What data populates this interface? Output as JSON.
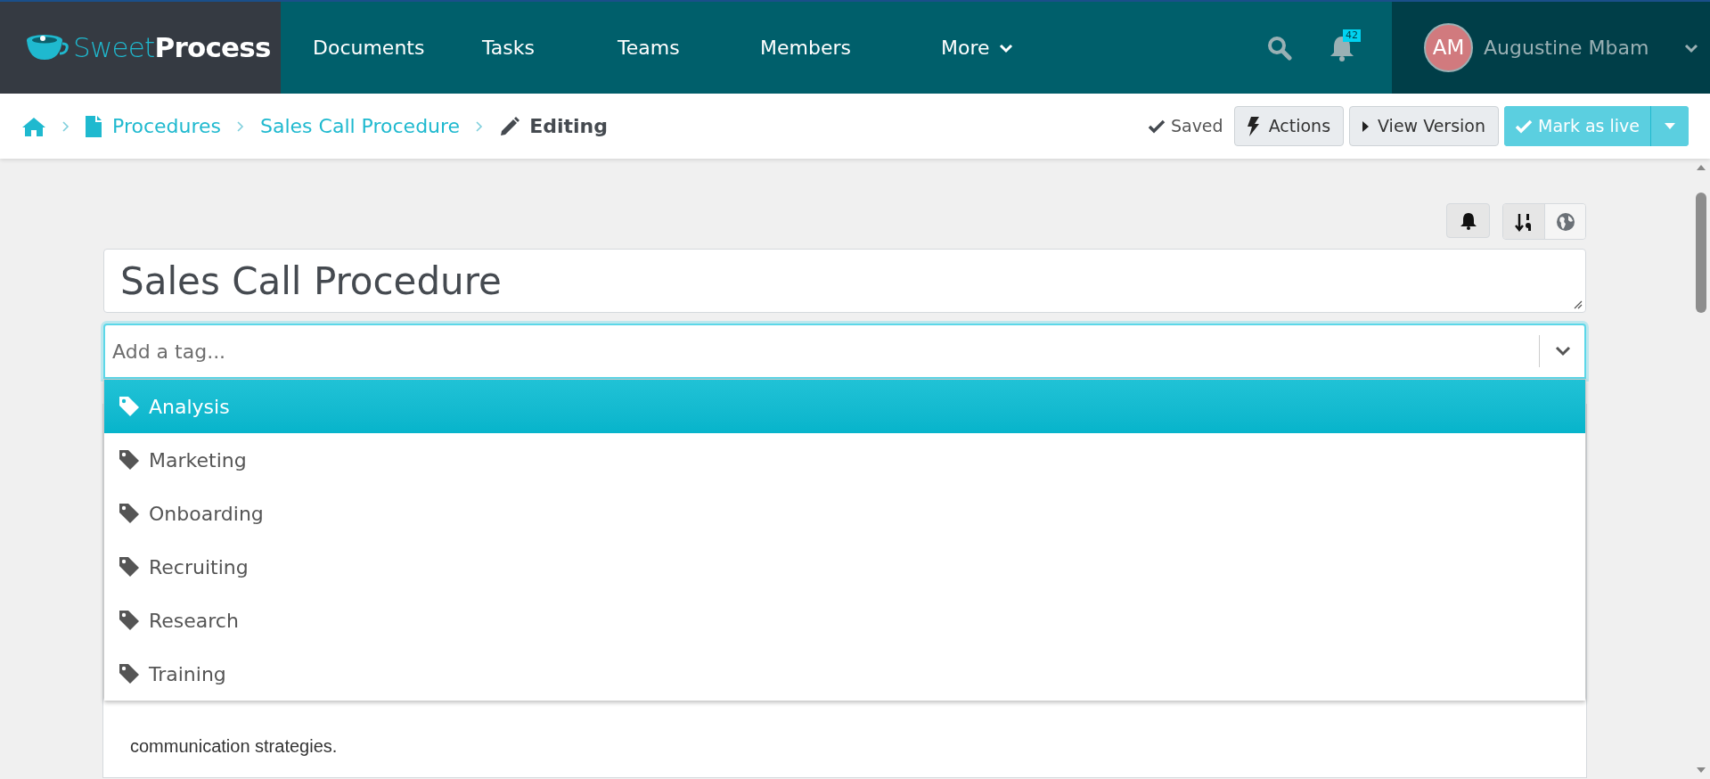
{
  "brand": {
    "name_light": "Sweet",
    "name_bold": "Process"
  },
  "nav": [
    {
      "label": "Documents",
      "kind": "link"
    },
    {
      "label": "Tasks",
      "kind": "link"
    },
    {
      "label": "Teams",
      "kind": "link"
    },
    {
      "label": "Members",
      "kind": "link"
    },
    {
      "label": "More",
      "kind": "menu"
    }
  ],
  "notifications": {
    "count": "42"
  },
  "user": {
    "initials": "AM",
    "name": "Augustine Mbam"
  },
  "breadcrumb": [
    {
      "label": "Procedures",
      "kind": "document"
    },
    {
      "label": "Sales Call Procedure",
      "kind": "link"
    },
    {
      "label": "Editing",
      "kind": "current"
    }
  ],
  "status": "Saved",
  "buttons": [
    {
      "label": "Actions",
      "kind": "actions"
    },
    {
      "label": "View Version",
      "kind": "view"
    },
    {
      "label": "Mark as live",
      "kind": "primary"
    }
  ],
  "title": "Sales Call Procedure",
  "tag_field": {
    "placeholder": "Add a tag..."
  },
  "tag_options": [
    {
      "label": "Analysis",
      "selected": true
    },
    {
      "label": "Marketing",
      "selected": false
    },
    {
      "label": "Onboarding",
      "selected": false
    },
    {
      "label": "Recruiting",
      "selected": false
    },
    {
      "label": "Research",
      "selected": false
    },
    {
      "label": "Training",
      "selected": false
    }
  ],
  "description": "communication strategies."
}
